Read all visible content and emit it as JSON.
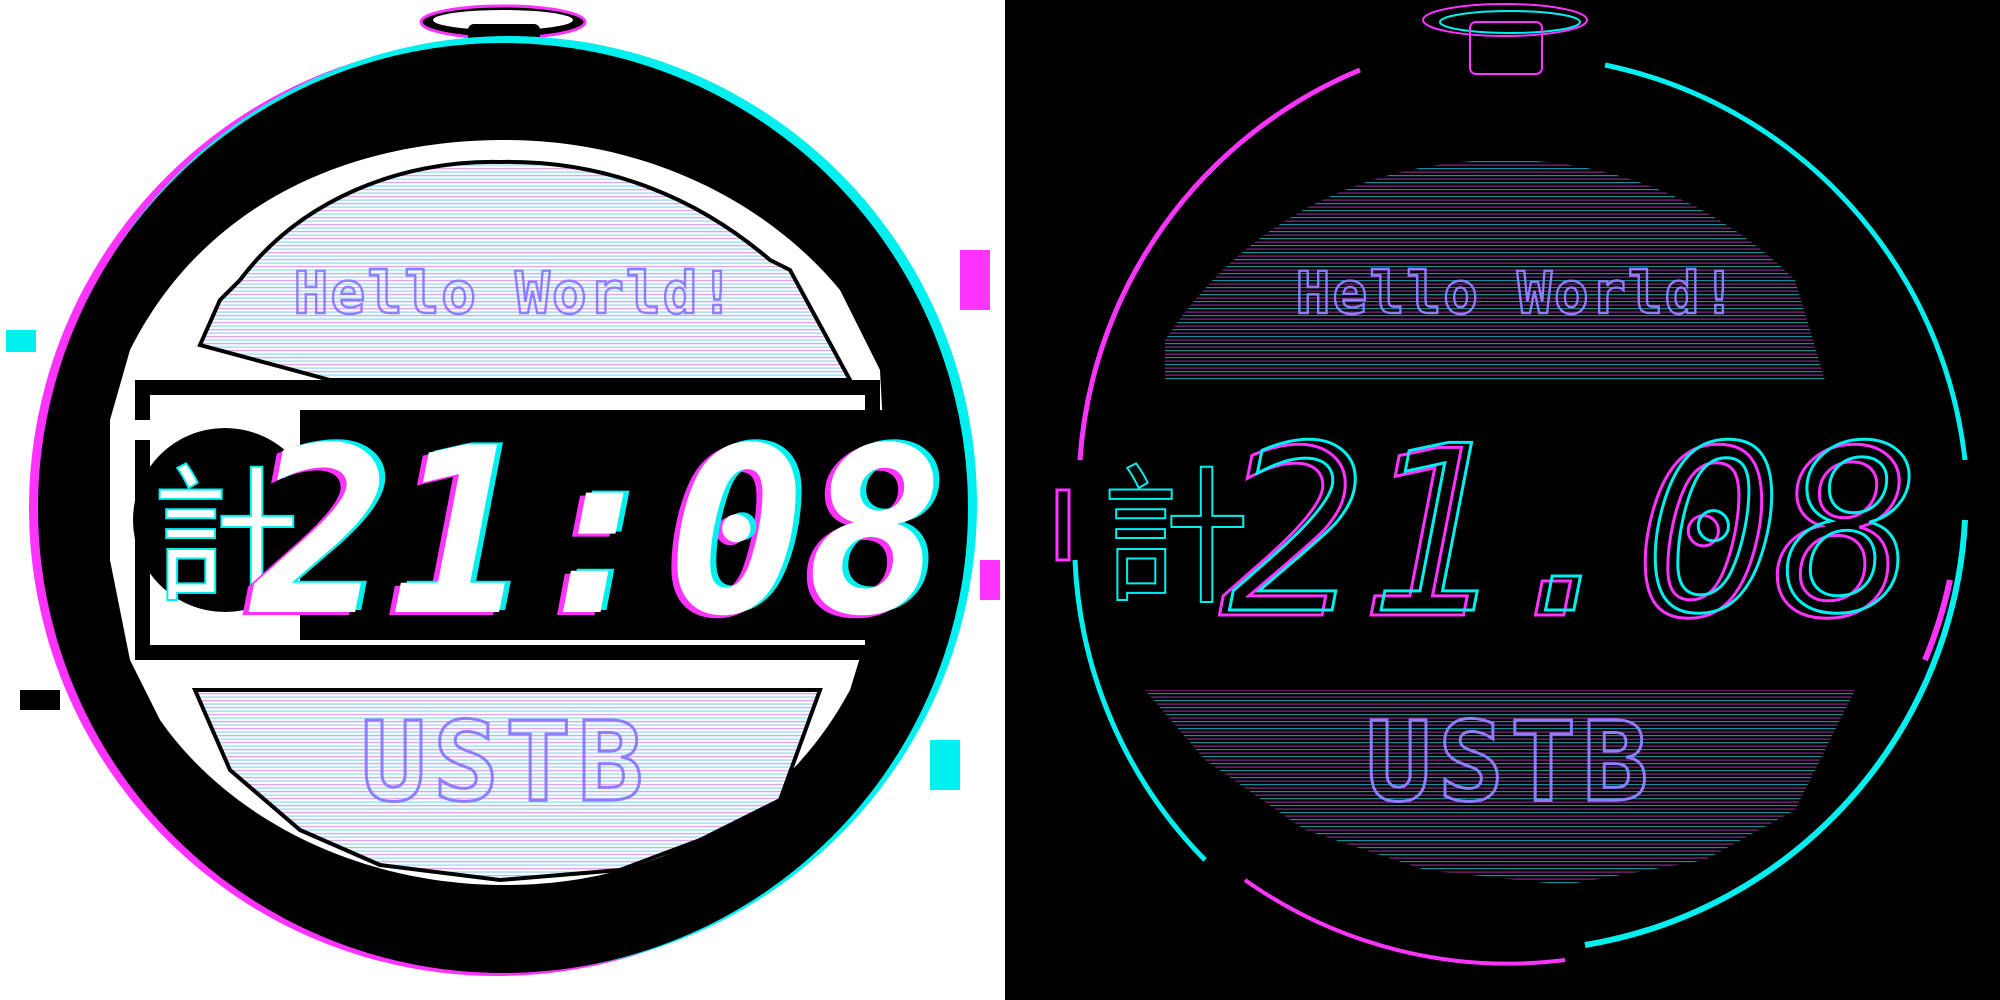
{
  "colors": {
    "cyan": "#00f0f0",
    "magenta": "#ff33ff",
    "violet": "#8f7cff",
    "light_background": "#ffffff",
    "dark_background": "#000000",
    "ink": "#000000"
  },
  "watch_light": {
    "greeting": "Hello World!",
    "kanji": "計",
    "time": "21:08",
    "brand": "USTB"
  },
  "watch_dark": {
    "greeting": "Hello World!",
    "kanji": "計",
    "time": "21.08",
    "brand": "USTB"
  }
}
